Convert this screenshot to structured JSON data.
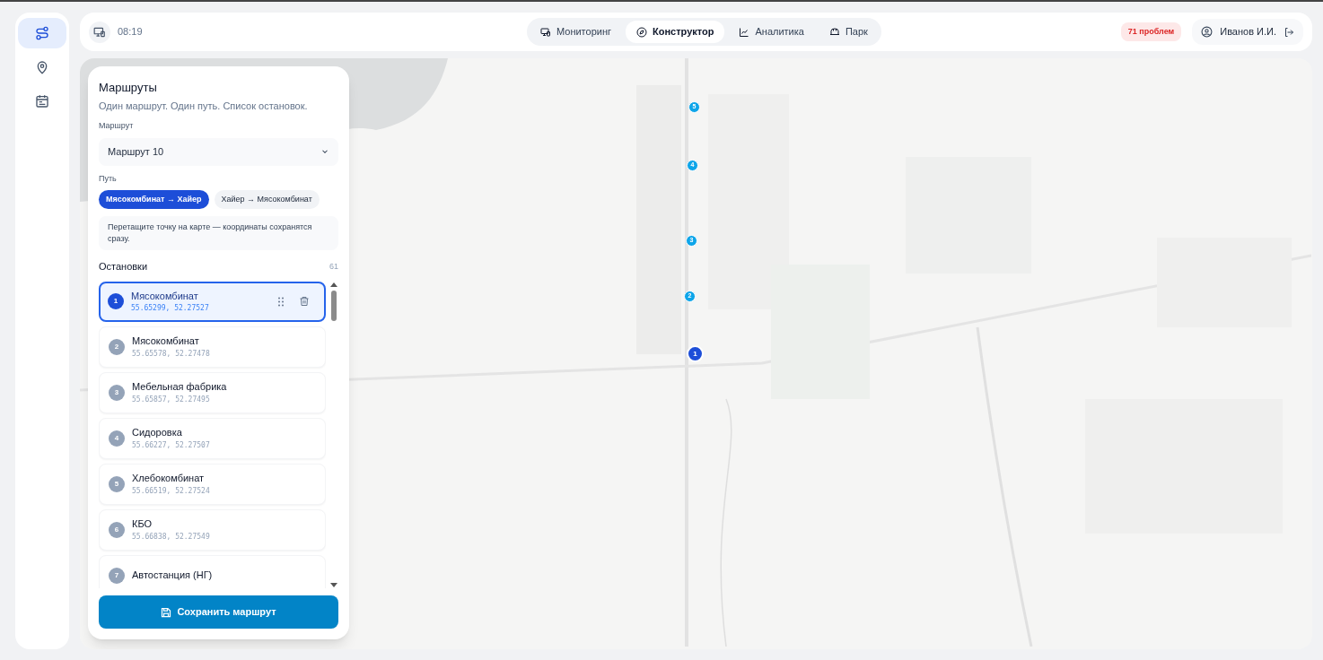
{
  "sidebar": {
    "items": [
      {
        "kind": "routes",
        "selected": true
      },
      {
        "kind": "pin",
        "selected": false
      },
      {
        "kind": "calendar",
        "selected": false
      }
    ]
  },
  "header": {
    "time": "08:19",
    "tabs": [
      {
        "label": "Мониторинг",
        "kind": "monitor",
        "selected": false
      },
      {
        "label": "Конструктор",
        "kind": "compass",
        "selected": true
      },
      {
        "label": "Аналитика",
        "kind": "chart",
        "selected": false
      },
      {
        "label": "Парк",
        "kind": "bus",
        "selected": false
      }
    ],
    "problems": "71 проблем",
    "user": "Иванов И.И."
  },
  "panel": {
    "title": "Маршруты",
    "subtitle": "Один маршрут. Один путь. Список остановок.",
    "route_label": "Маршрут",
    "route_value": "Маршрут 10",
    "path_label": "Путь",
    "paths": [
      {
        "label": "Мясокомбинат → Хайер",
        "selected": true
      },
      {
        "label": "Хайер → Мясокомбинат",
        "selected": false
      }
    ],
    "hint": "Перетащите точку на карте — координаты сохранятся сразу.",
    "stops_label": "Остановки",
    "stops_count": "61",
    "stops": [
      {
        "number": "1",
        "name": "Мясокомбинат",
        "coords": "55.65299, 52.27527",
        "selected": true
      },
      {
        "number": "2",
        "name": "Мясокомбинат",
        "coords": "55.65578, 52.27478",
        "selected": false
      },
      {
        "number": "3",
        "name": "Мебельная фабрика",
        "coords": "55.65857, 52.27495",
        "selected": false
      },
      {
        "number": "4",
        "name": "Сидоровка",
        "coords": "55.66227, 52.27507",
        "selected": false
      },
      {
        "number": "5",
        "name": "Хлебокомбинат",
        "coords": "55.66519, 52.27524",
        "selected": false
      },
      {
        "number": "6",
        "name": "КБО",
        "coords": "55.66838, 52.27549",
        "selected": false
      },
      {
        "number": "7",
        "name": "Автостанция (НГ)",
        "selected": false
      }
    ],
    "save_button": "Сохранить маршрут"
  },
  "map": {
    "markers": [
      {
        "label": "5",
        "selected": false
      },
      {
        "label": "4",
        "selected": false
      },
      {
        "label": "3",
        "selected": false
      },
      {
        "label": "2",
        "selected": false
      },
      {
        "label": "1",
        "selected": true
      }
    ]
  }
}
